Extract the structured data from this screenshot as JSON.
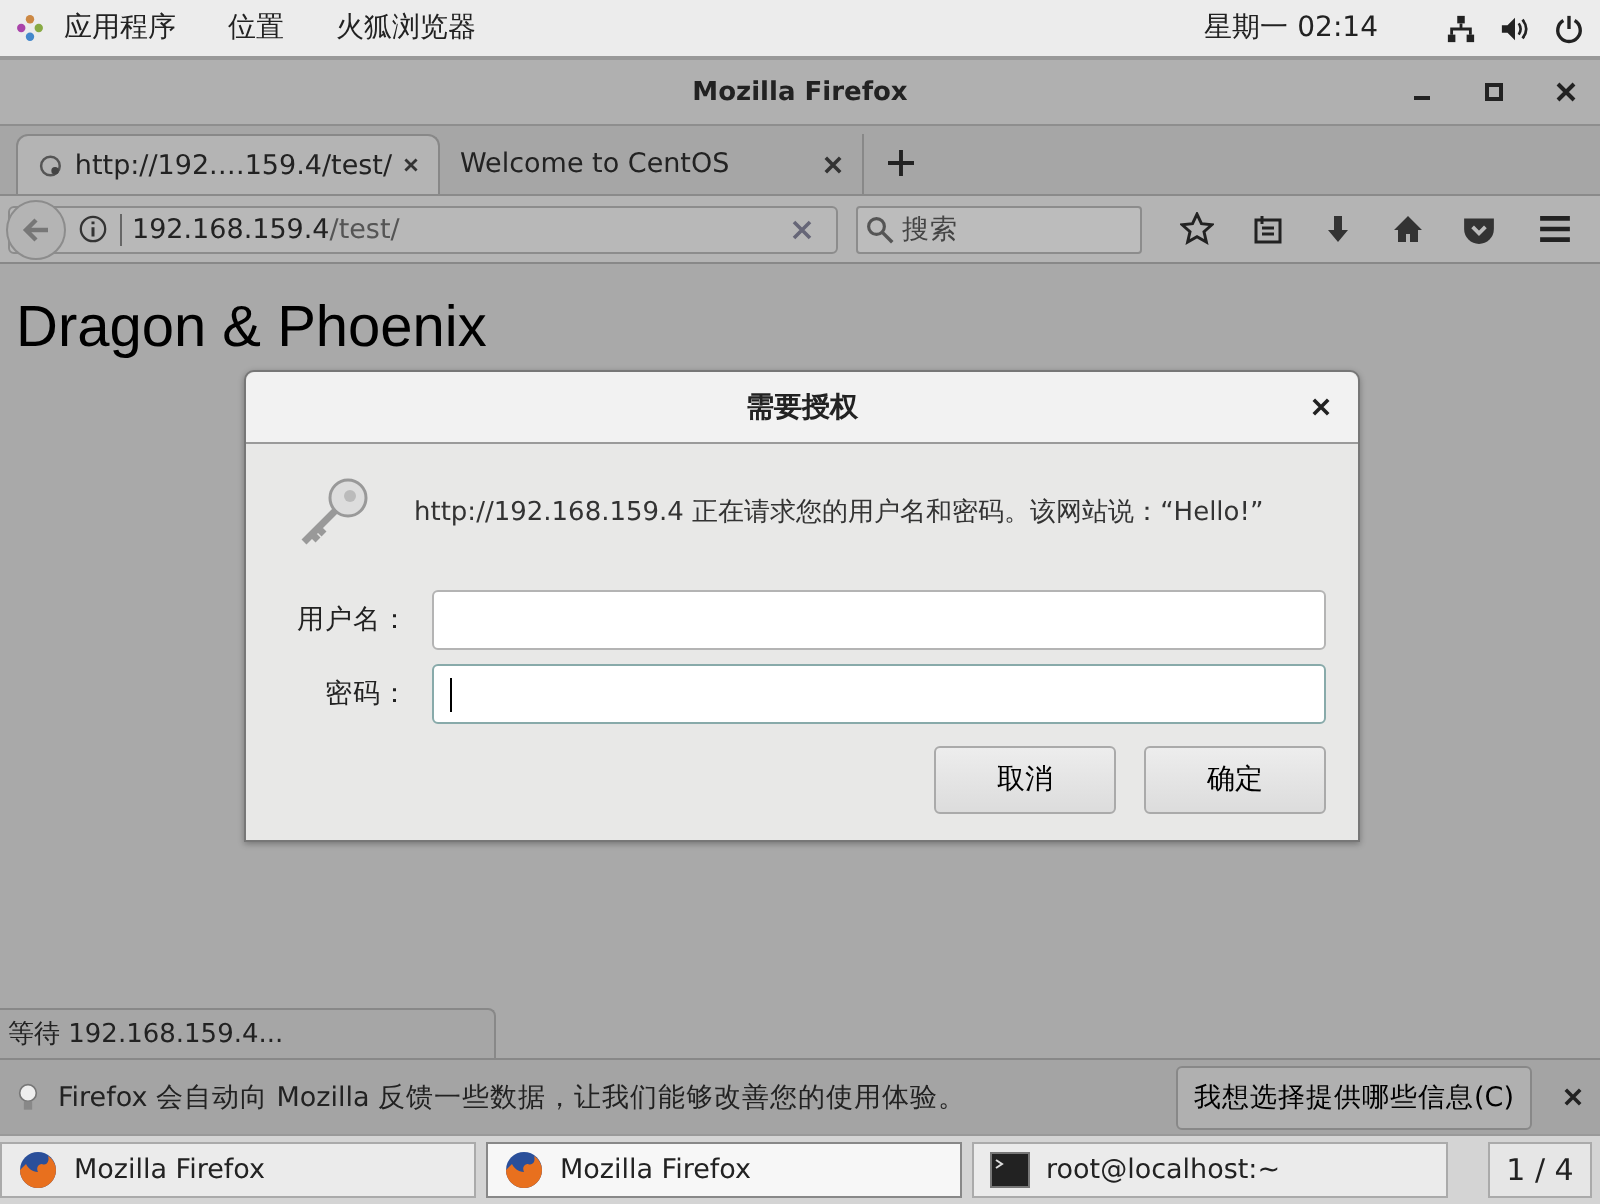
{
  "top_bar": {
    "menus": [
      "应用程序",
      "位置",
      "火狐浏览器"
    ],
    "clock": "星期一 02:14"
  },
  "window": {
    "title": "Mozilla Firefox"
  },
  "tabs": [
    {
      "label": "http://192.…159.4/test/",
      "selected": true,
      "loading": true
    },
    {
      "label": "Welcome to CentOS",
      "selected": false,
      "loading": false
    }
  ],
  "nav": {
    "url_host": "192.168.159.4",
    "url_path": "/test/",
    "search_placeholder": "搜索"
  },
  "page": {
    "heading": "Dragon & Phoenix",
    "status": "等待 192.168.159.4..."
  },
  "dialog": {
    "title": "需要授权",
    "message": "http://192.168.159.4 正在请求您的用户名和密码。该网站说：“Hello!”",
    "fields": [
      {
        "label": "用户名：",
        "focused": false
      },
      {
        "label": "密码：",
        "focused": true
      }
    ],
    "buttons": [
      "取消",
      "确定"
    ]
  },
  "notification": {
    "text": "Firefox 会自动向 Mozilla 反馈一些数据，让我们能够改善您的使用体验。",
    "button": "我想选择提供哪些信息(C)"
  },
  "taskbar": {
    "items": [
      {
        "label": "Mozilla Firefox",
        "kind": "firefox",
        "selected": false
      },
      {
        "label": "Mozilla Firefox",
        "kind": "firefox",
        "selected": true
      },
      {
        "label": "root@localhost:~",
        "kind": "terminal",
        "selected": false
      }
    ],
    "workspace": "1 / 4"
  }
}
